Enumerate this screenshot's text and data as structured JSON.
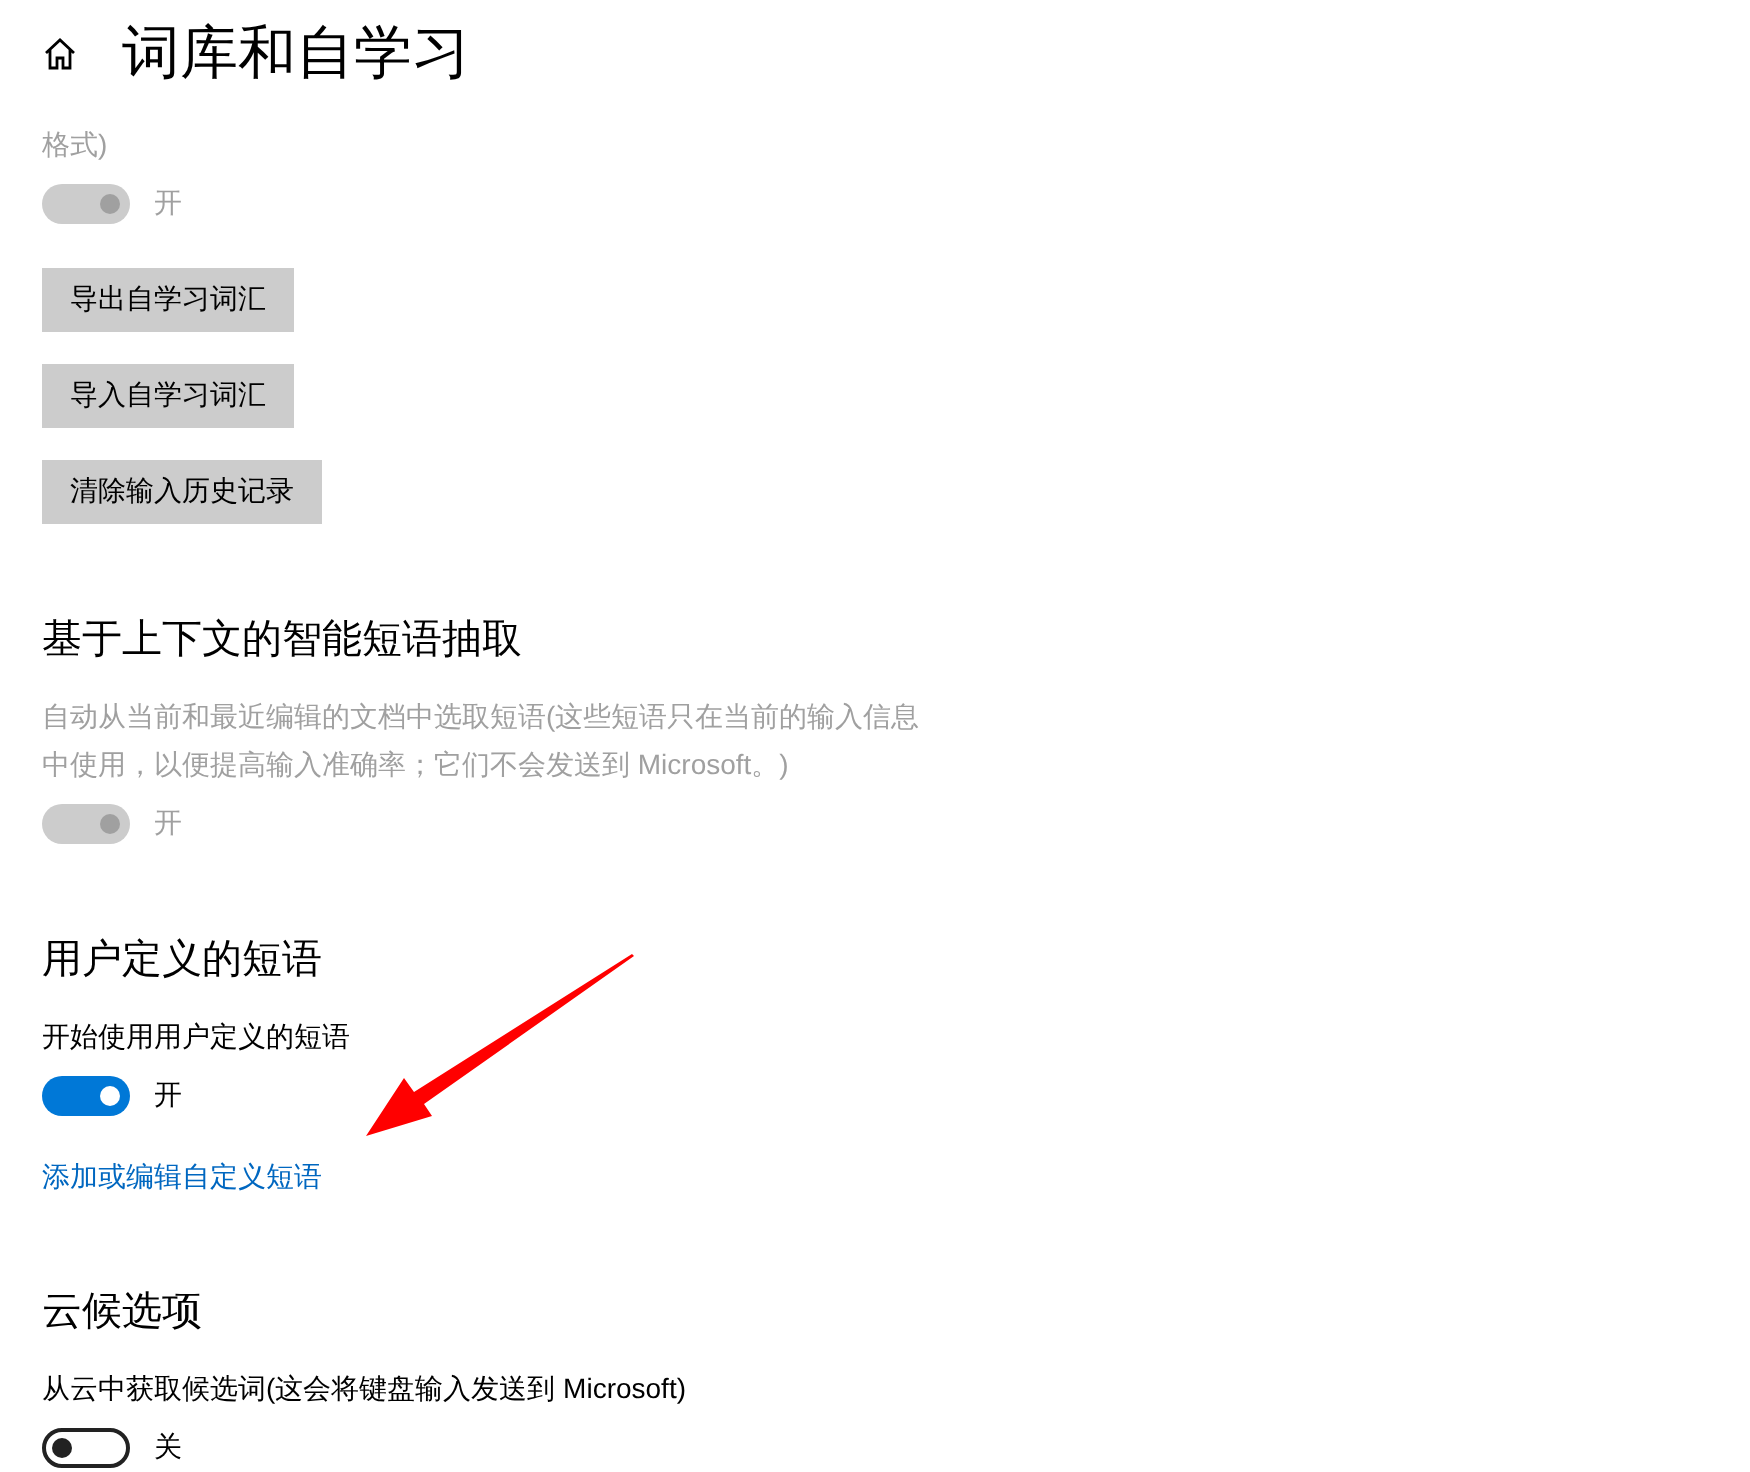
{
  "header": {
    "title": "词库和自学习"
  },
  "blocks": [
    {
      "kind": "note",
      "text": "格式)",
      "disabled": true
    },
    {
      "kind": "toggle",
      "on": true,
      "disabled": true,
      "label": "开"
    },
    {
      "kind": "button",
      "label": "导出自学习词汇"
    },
    {
      "kind": "button",
      "label": "导入自学习词汇"
    },
    {
      "kind": "button",
      "label": "清除输入历史记录"
    },
    {
      "kind": "heading",
      "text": "基于上下文的智能短语抽取"
    },
    {
      "kind": "note",
      "text": "自动从当前和最近编辑的文档中选取短语(这些短语只在当前的输入信息中使用，以便提高输入准确率；它们不会发送到 Microsoft。)",
      "disabled": true
    },
    {
      "kind": "toggle",
      "on": true,
      "disabled": true,
      "label": "开"
    },
    {
      "kind": "heading",
      "text": "用户定义的短语"
    },
    {
      "kind": "note",
      "text": "开始使用用户定义的短语",
      "disabled": false
    },
    {
      "kind": "toggle",
      "on": true,
      "disabled": false,
      "label": "开"
    },
    {
      "kind": "link",
      "text": "添加或编辑自定义短语"
    },
    {
      "kind": "heading",
      "text": "云候选项"
    },
    {
      "kind": "note",
      "text": "从云中获取候选词(这会将键盘输入发送到 Microsoft)",
      "disabled": false
    },
    {
      "kind": "toggle",
      "on": false,
      "disabled": false,
      "label": "关"
    }
  ]
}
